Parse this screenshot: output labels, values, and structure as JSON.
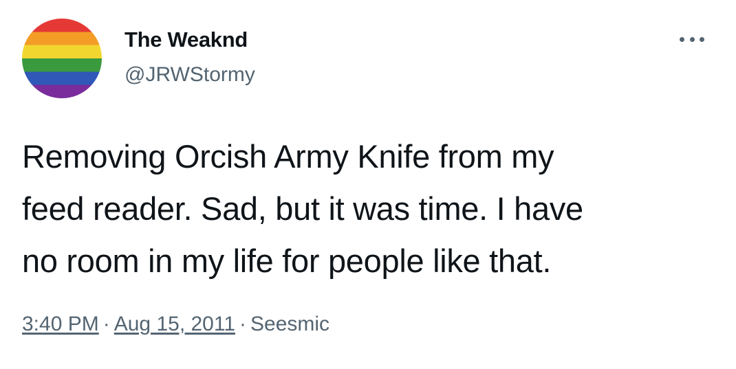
{
  "tweet": {
    "display_name": "The Weaknd",
    "handle": "@JRWStormy",
    "text_lines": [
      "Removing Orcish Army Knife from my",
      "feed reader. Sad, but it was time. I have",
      "no room in my life for people like that."
    ],
    "time": "3:40 PM",
    "separator_1": "·",
    "date": "Aug 15, 2011",
    "separator_2": "·",
    "source": "Seesmic",
    "avatar_icon": "rainbow-flag-avatar",
    "more_icon": "more-horizontal-icon",
    "colors": {
      "text": "#0f1419",
      "secondary": "#536471",
      "background": "#ffffff"
    }
  }
}
